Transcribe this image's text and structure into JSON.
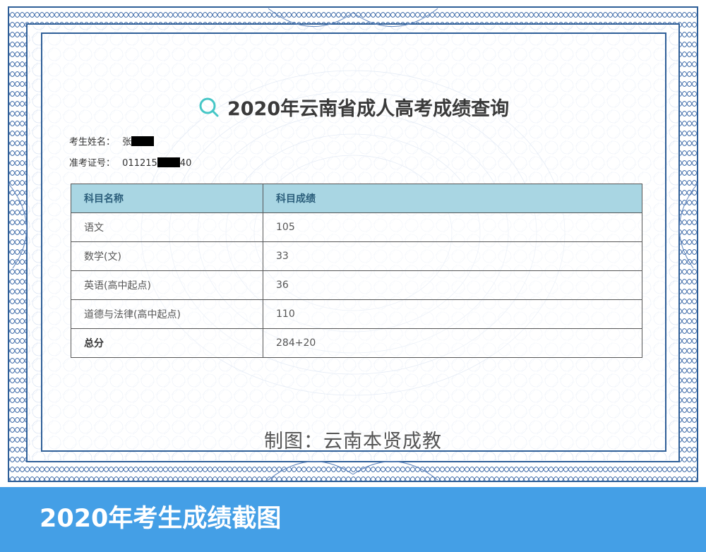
{
  "page": {
    "title": "2020年云南省成人高考成绩查询",
    "watermark": "制图：云南本贤成教",
    "footer_caption": "2020年考生成绩截图"
  },
  "candidate": {
    "name_label": "考生姓名：",
    "name_value": "张",
    "id_label": "准考证号：",
    "id_prefix": "011215",
    "id_suffix": "40"
  },
  "table": {
    "headers": [
      "科目名称",
      "科目成绩"
    ],
    "rows": [
      {
        "subject": "语文",
        "score": "105"
      },
      {
        "subject": "数学(文)",
        "score": "33"
      },
      {
        "subject": "英语(高中起点)",
        "score": "36"
      },
      {
        "subject": "道德与法律(高中起点)",
        "score": "110"
      },
      {
        "subject": "总分",
        "score": "284+20"
      }
    ]
  },
  "colors": {
    "frame_blue": "#2f5f98",
    "header_bg": "#a9d6e3",
    "header_text": "#2a5d7a",
    "footer_bg": "#449fe6",
    "search_icon": "#45c6c6"
  },
  "icons": {
    "title_icon": "search-icon"
  }
}
